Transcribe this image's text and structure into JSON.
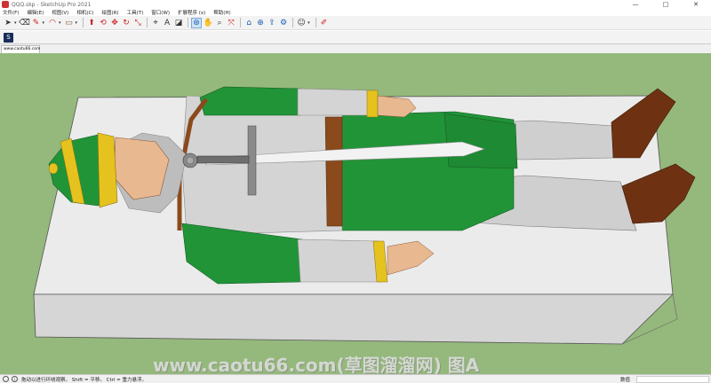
{
  "window": {
    "title": "QQQ.skp - SketchUp Pro 2021",
    "minimize": "—",
    "maximize": "□",
    "close": "✕"
  },
  "menu": {
    "items": [
      "文件(F)",
      "编辑(E)",
      "视图(V)",
      "相机(C)",
      "绘图(R)",
      "工具(T)",
      "窗口(W)",
      "扩展程序 (x)",
      "帮助(H)"
    ]
  },
  "toolbar": {
    "buttons": [
      {
        "name": "select-icon",
        "glyph": "➤"
      },
      {
        "name": "eraser-icon",
        "glyph": "⌫"
      },
      {
        "name": "line-icon",
        "glyph": "✎"
      },
      {
        "name": "arc-icon",
        "glyph": "◠"
      },
      {
        "name": "rectangle-icon",
        "glyph": "▭"
      },
      {
        "name": "push-pull-icon",
        "glyph": "⬆"
      },
      {
        "name": "offset-icon",
        "glyph": "⟲"
      },
      {
        "name": "move-icon",
        "glyph": "✥"
      },
      {
        "name": "rotate-icon",
        "glyph": "↻"
      },
      {
        "name": "scale-icon",
        "glyph": "⤡"
      },
      {
        "name": "tape-measure-icon",
        "glyph": "⌖"
      },
      {
        "name": "text-icon",
        "glyph": "A"
      },
      {
        "name": "paint-bucket-icon",
        "glyph": "◪"
      },
      {
        "name": "orbit-icon",
        "glyph": "⊛"
      },
      {
        "name": "pan-icon",
        "glyph": "✋"
      },
      {
        "name": "zoom-icon",
        "glyph": "⌕"
      },
      {
        "name": "zoom-extents-icon",
        "glyph": "⤧"
      },
      {
        "name": "warehouse-icon",
        "glyph": "⌂"
      },
      {
        "name": "extension-warehouse-icon",
        "glyph": "⊕"
      },
      {
        "name": "send-layout-icon",
        "glyph": "⇪"
      },
      {
        "name": "extension-manager-icon",
        "glyph": "⚙"
      },
      {
        "name": "account-icon",
        "glyph": "☺"
      },
      {
        "name": "sketch-icon",
        "glyph": "✐"
      }
    ]
  },
  "scene": {
    "tab_label": "www.caotu66.com"
  },
  "watermark": {
    "text": "www.caotu66.com(草图溜溜网) 图A"
  },
  "status": {
    "hint": "拖动以进行环绕观察。 Shift = 平移。 Ctrl = 重力悬浮。",
    "measure_label": "数值",
    "info_glyph": "i"
  },
  "colors": {
    "viewport_bg": "#95b87c",
    "tunic_green": "#219438",
    "sleeve_grey": "#d4d4d4",
    "belt_brown": "#8b4a1c",
    "boot_brown": "#6e3212",
    "helmet_gold": "#e6c21e"
  }
}
